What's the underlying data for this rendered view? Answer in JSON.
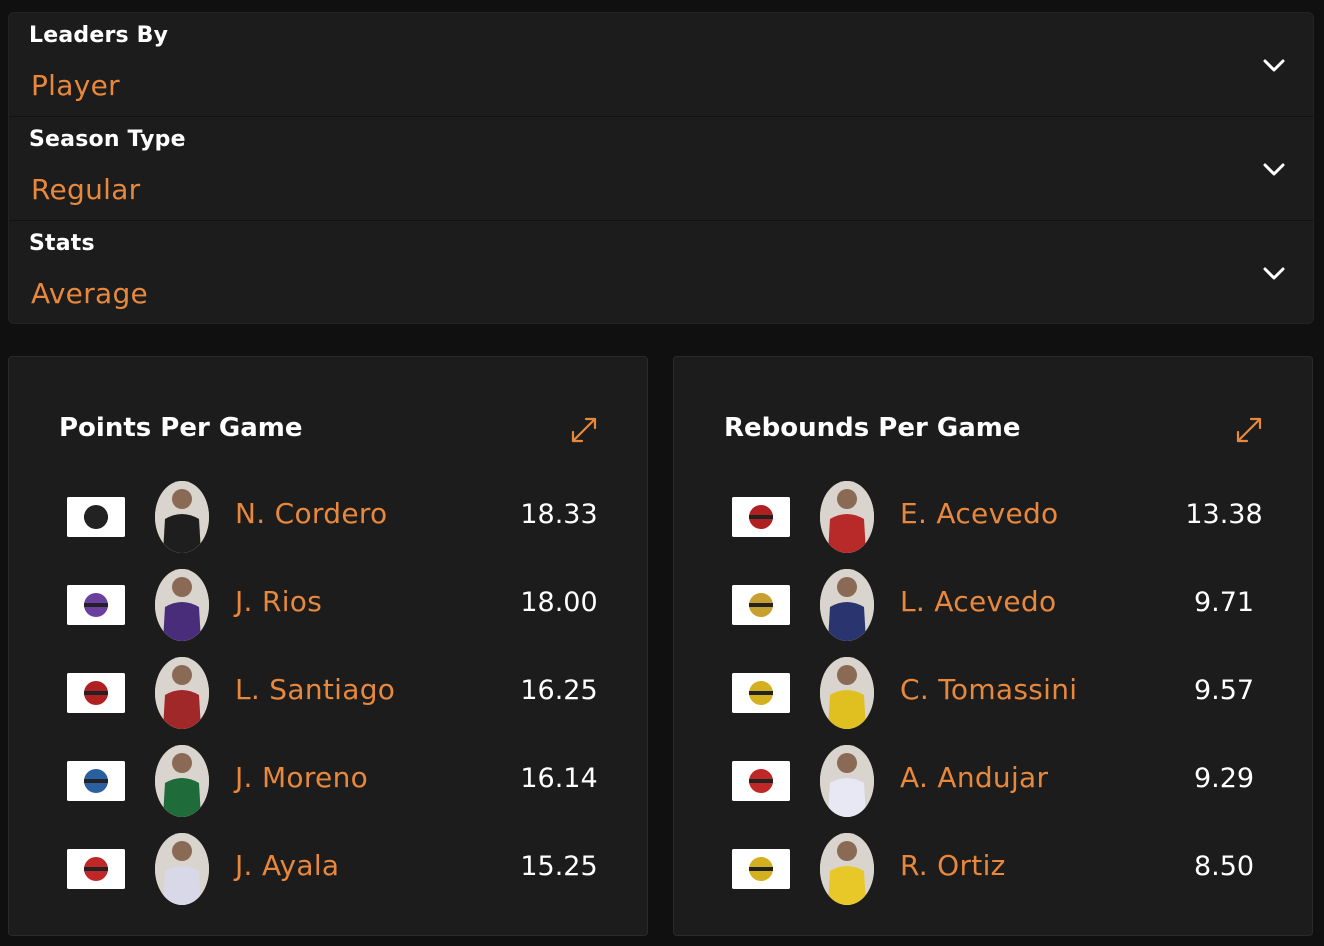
{
  "filters": [
    {
      "label": "Leaders By",
      "value": "Player",
      "icon": "chevron-down-icon"
    },
    {
      "label": "Season Type",
      "value": "Regular",
      "icon": "chevron-down-icon"
    },
    {
      "label": "Stats",
      "value": "Average",
      "icon": "chevron-down-icon"
    }
  ],
  "colors": {
    "accent": "#e8883c",
    "background": "#101010",
    "card": "#1c1c1c",
    "text": "#ffffff"
  },
  "cards": [
    {
      "title": "Points Per Game",
      "expand_icon": "expand-icon",
      "leaders": [
        {
          "name": "N. Cordero",
          "value": "18.33",
          "logo_color": "#222222",
          "jersey": "#1e1e1e"
        },
        {
          "name": "J. Rios",
          "value": "18.00",
          "logo_color": "#6b3fa0",
          "jersey": "#4a2d7a"
        },
        {
          "name": "L. Santiago",
          "value": "16.25",
          "logo_color": "#b02020",
          "jersey": "#a02828"
        },
        {
          "name": "J. Moreno",
          "value": "16.14",
          "logo_color": "#2a5fa0",
          "jersey": "#1f6b3a"
        },
        {
          "name": "J. Ayala",
          "value": "15.25",
          "logo_color": "#c02828",
          "jersey": "#d8d8e8"
        }
      ]
    },
    {
      "title": "Rebounds Per Game",
      "expand_icon": "expand-icon",
      "leaders": [
        {
          "name": "E. Acevedo",
          "value": "13.38",
          "logo_color": "#b02020",
          "jersey": "#b82a2a"
        },
        {
          "name": "L. Acevedo",
          "value": "9.71",
          "logo_color": "#c8a030",
          "jersey": "#2a3570"
        },
        {
          "name": "C. Tomassini",
          "value": "9.57",
          "logo_color": "#d4b020",
          "jersey": "#e0c020"
        },
        {
          "name": "A. Andujar",
          "value": "9.29",
          "logo_color": "#c02828",
          "jersey": "#e8e8f4"
        },
        {
          "name": "R. Ortiz",
          "value": "8.50",
          "logo_color": "#d4b020",
          "jersey": "#e8c828"
        }
      ]
    }
  ]
}
